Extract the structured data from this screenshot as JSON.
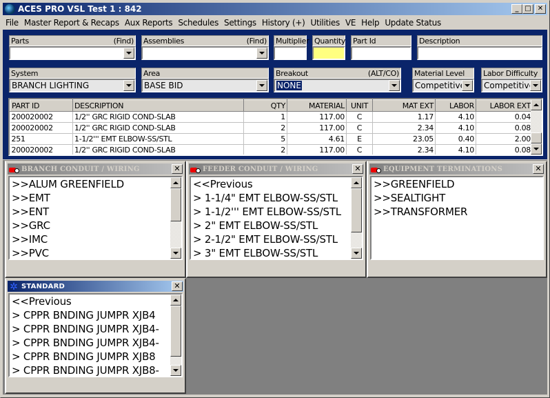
{
  "window": {
    "title": "ACES PRO  VSL Test 1 : 842",
    "buttons": {
      "minimize": "_",
      "maximize": "□",
      "close": "✕"
    }
  },
  "menu": [
    {
      "label": "File"
    },
    {
      "label": "Master Report & Recaps"
    },
    {
      "label": "Aux Reports"
    },
    {
      "label": "Schedules"
    },
    {
      "label": "Settings"
    },
    {
      "label": "History (+)"
    },
    {
      "label": "Utilities"
    },
    {
      "label": "VE"
    },
    {
      "label": "Help"
    },
    {
      "label": "Update Status"
    }
  ],
  "fields": {
    "parts": {
      "label": "Parts",
      "action": "(Find)",
      "value": ""
    },
    "assemblies": {
      "label": "Assemblies",
      "action": "(Find)",
      "value": ""
    },
    "multiplier": {
      "label": "Multiplier",
      "value": ""
    },
    "quantity": {
      "label": "Quantity",
      "value": ""
    },
    "part_id": {
      "label": "Part Id",
      "value": ""
    },
    "description": {
      "label": "Description",
      "value": ""
    },
    "system": {
      "label": "System",
      "value": "BRANCH LIGHTING"
    },
    "area": {
      "label": "Area",
      "value": "BASE BID"
    },
    "breakout": {
      "label": "Breakout",
      "action": "(ALT/CO)",
      "value": "NONE"
    },
    "material_level": {
      "label": "Material Level",
      "value": "Competitive"
    },
    "labor_difficulty": {
      "label": "Labor Difficulty",
      "value": "Competitive"
    }
  },
  "grid": {
    "columns": [
      "PART ID",
      "DESCRIPTION",
      "QTY",
      "MATERIAL",
      "UNIT",
      "MAT EXT",
      "LABOR",
      "LABOR EXT"
    ],
    "rows": [
      [
        "200020002",
        "1/2''  GRC RIGID COND-SLAB",
        "1",
        "117.00",
        "C",
        "1.17",
        "4.10",
        "0.04"
      ],
      [
        "200020002",
        "1/2''  GRC RIGID COND-SLAB",
        "2",
        "117.00",
        "C",
        "2.34",
        "4.10",
        "0.08"
      ],
      [
        "251",
        "1-1/2''' EMT ELBOW-SS/STL",
        "5",
        "4.61",
        "E",
        "23.05",
        "0.40",
        "2.00"
      ],
      [
        "200020002",
        "1/2''  GRC RIGID COND-SLAB",
        "2",
        "117.00",
        "C",
        "2.34",
        "4.10",
        "0.08"
      ]
    ]
  },
  "panels": {
    "branch": {
      "title": "BRANCH CONDUIT / WIRING",
      "items": [
        ">>ALUM GREENFIELD",
        ">>EMT",
        ">>ENT",
        ">>GRC",
        ">>IMC",
        ">>PVC"
      ]
    },
    "feeder": {
      "title": "FEEDER CONDUIT / WIRING",
      "items": [
        "<<Previous",
        ">  1-1/4\" EMT ELBOW-SS/STL",
        ">  1-1/2''' EMT ELBOW-SS/STL",
        ">  2\" EMT ELBOW-SS/STL",
        ">  2-1/2\" EMT ELBOW-SS/STL",
        ">  3\" EMT ELBOW-SS/STL"
      ]
    },
    "equipment": {
      "title": "EQUIPMENT TERMINATIONS",
      "items": [
        ">>GREENFIELD",
        ">>SEALTIGHT",
        ">>TRANSFORMER"
      ]
    },
    "standard": {
      "title": "STANDARD",
      "items": [
        "<<Previous",
        ">  CPPR BNDING JUMPR  XJB4",
        ">  CPPR BNDING JUMPR XJB4-",
        ">  CPPR BNDING JUMPR XJB4-",
        ">  CPPR BNDING JUMPR  XJB8",
        ">  CPPR BNDING JUMPR XJB8-"
      ]
    },
    "close_label": "✕"
  },
  "colors": {
    "titlebar_start": "#0a246a",
    "titlebar_end": "#a6caf0",
    "form_background": "#0a246a",
    "quantity_highlight": "#ffff80",
    "mdi_background": "#808080"
  }
}
